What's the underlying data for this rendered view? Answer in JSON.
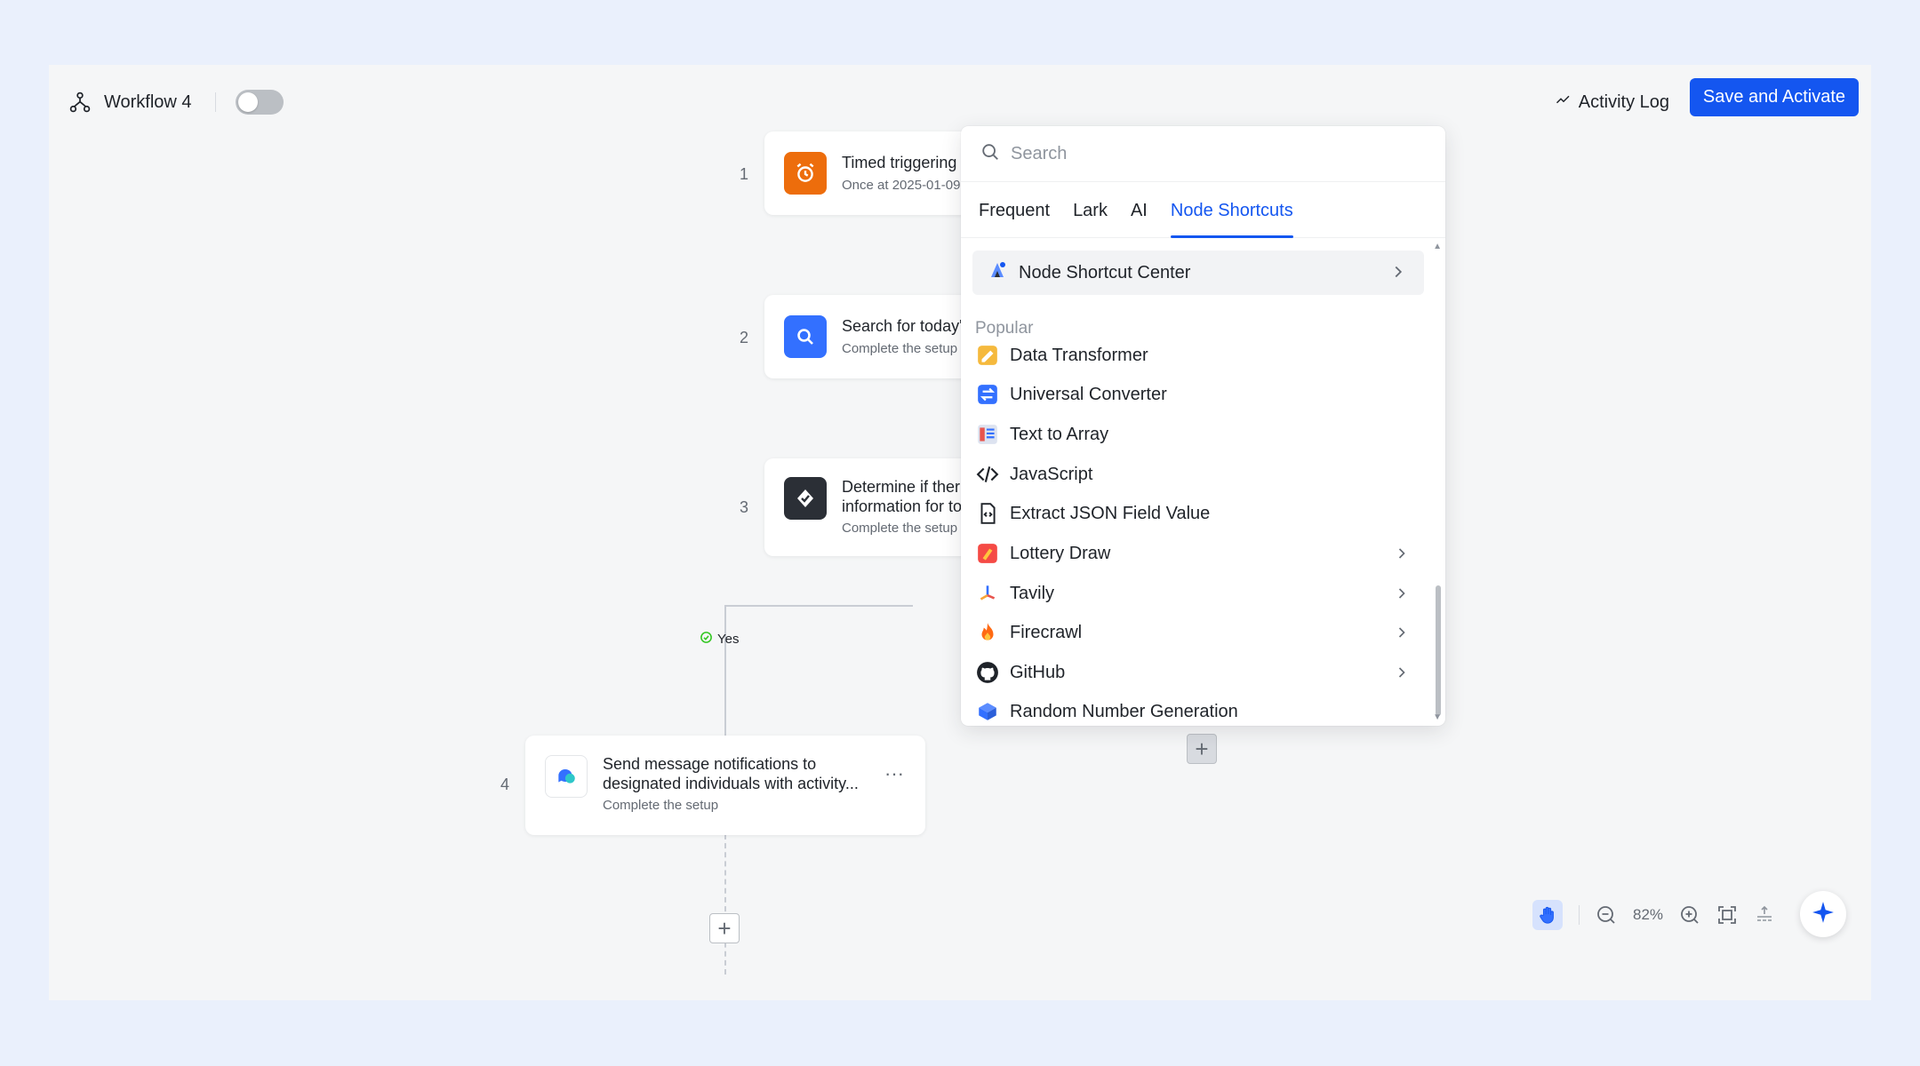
{
  "header": {
    "workflow_name": "Workflow 4",
    "activity_log_label": "Activity Log",
    "save_label": "Save and Activate"
  },
  "nodes": [
    {
      "number": "1",
      "title": "Timed triggering",
      "subtitle": "Once at 2025-01-09",
      "icon": "alarm-clock-icon",
      "color": "#ed6d0c"
    },
    {
      "number": "2",
      "title": "Search for today'",
      "subtitle": "Complete the setup",
      "icon": "search-icon",
      "color": "#3370ff"
    },
    {
      "number": "3",
      "title_line1": "Determine if ther",
      "title_line2": "information for to",
      "subtitle": "Complete the setup",
      "icon": "condition-check-icon",
      "color": "#2b2f36"
    },
    {
      "number": "4",
      "title_line1": "Send message notifications to",
      "title_line2": "designated individuals with activity...",
      "subtitle": "Complete the setup",
      "icon": "message-bubble-icon",
      "more": "···"
    }
  ],
  "branch": {
    "yes_label": "Yes"
  },
  "panel": {
    "search_placeholder": "Search",
    "tabs": [
      "Frequent",
      "Lark",
      "AI",
      "Node Shortcuts"
    ],
    "active_tab": "Node Shortcuts",
    "center_label": "Node Shortcut Center",
    "section_title": "Popular",
    "items": [
      {
        "label": "Data Transformer",
        "icon": "data-transformer-icon",
        "has_submenu": false
      },
      {
        "label": "Universal Converter",
        "icon": "universal-converter-icon",
        "has_submenu": false
      },
      {
        "label": "Text to Array",
        "icon": "text-to-array-icon",
        "has_submenu": false
      },
      {
        "label": "JavaScript",
        "icon": "code-icon",
        "has_submenu": false
      },
      {
        "label": "Extract JSON Field Value",
        "icon": "json-file-icon",
        "has_submenu": false
      },
      {
        "label": "Lottery Draw",
        "icon": "lottery-icon",
        "has_submenu": true
      },
      {
        "label": "Tavily",
        "icon": "tavily-icon",
        "has_submenu": true
      },
      {
        "label": "Firecrawl",
        "icon": "fire-icon",
        "has_submenu": true
      },
      {
        "label": "GitHub",
        "icon": "github-icon",
        "has_submenu": true
      },
      {
        "label": "Random Number Generation",
        "icon": "random-number-icon",
        "has_submenu": false
      }
    ]
  },
  "toolbar": {
    "zoom": "82%"
  },
  "colors": {
    "accent": "#1456f0",
    "canvas": "#f5f6f7",
    "page": "#eaf0fc"
  }
}
